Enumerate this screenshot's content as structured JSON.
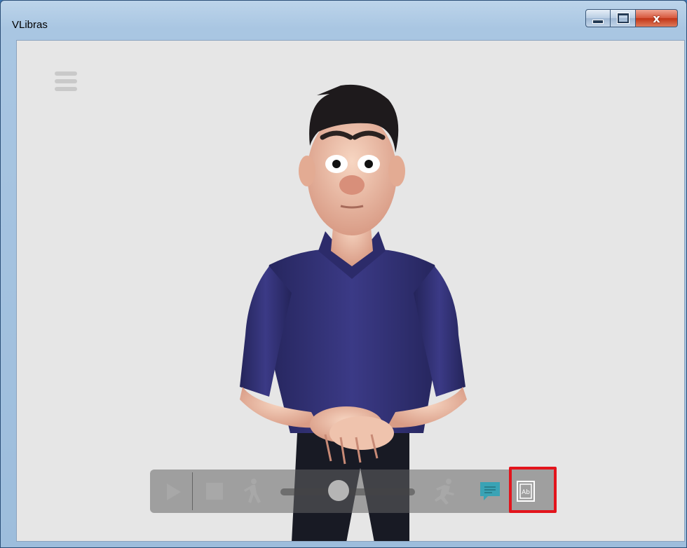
{
  "window": {
    "title": "VLibras",
    "controls": {
      "minimize": "minimize",
      "maximize": "maximize",
      "close": "x"
    }
  },
  "player": {
    "menu_icon": "hamburger-menu-icon",
    "avatar": "3d-sign-language-avatar",
    "controls": {
      "play_icon": "play-icon",
      "stop_icon": "stop-icon",
      "slow_speed_icon": "walking-person-icon",
      "speed_slider_value": 0.5,
      "fast_speed_icon": "running-person-icon",
      "subtitles_icon": "speech-bubble-icon",
      "dictionary_icon": "dictionary-ab-icon",
      "dictionary_label": "Ab"
    }
  },
  "colors": {
    "highlight": "#e3141c",
    "shirt": "#2f2e6e",
    "subtitle_accent": "#3aa3b5"
  }
}
